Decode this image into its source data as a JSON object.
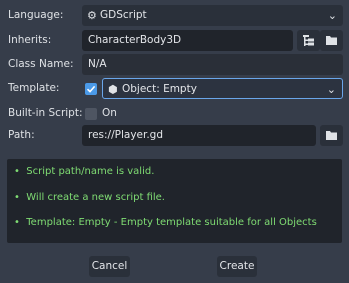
{
  "form": {
    "language": {
      "label": "Language:",
      "value": "GDScript"
    },
    "inherits": {
      "label": "Inherits:",
      "value": "CharacterBody3D"
    },
    "class_name": {
      "label": "Class Name:",
      "value": "N/A"
    },
    "template": {
      "label": "Template:",
      "checked": true,
      "value": "Object: Empty"
    },
    "builtin": {
      "label": "Built-in Script:",
      "checked": false,
      "value": "On"
    },
    "path": {
      "label": "Path:",
      "value": "res://Player.gd"
    }
  },
  "messages": [
    "Script path/name is valid.",
    "Will create a new script file.",
    "Template: Empty - Empty template suitable for all Objects"
  ],
  "buttons": {
    "cancel": "Cancel",
    "create": "Create"
  },
  "colors": {
    "background": "#363d4a",
    "field": "#20242b",
    "accent": "#4b9ae8",
    "success_text": "#7fdc73"
  }
}
